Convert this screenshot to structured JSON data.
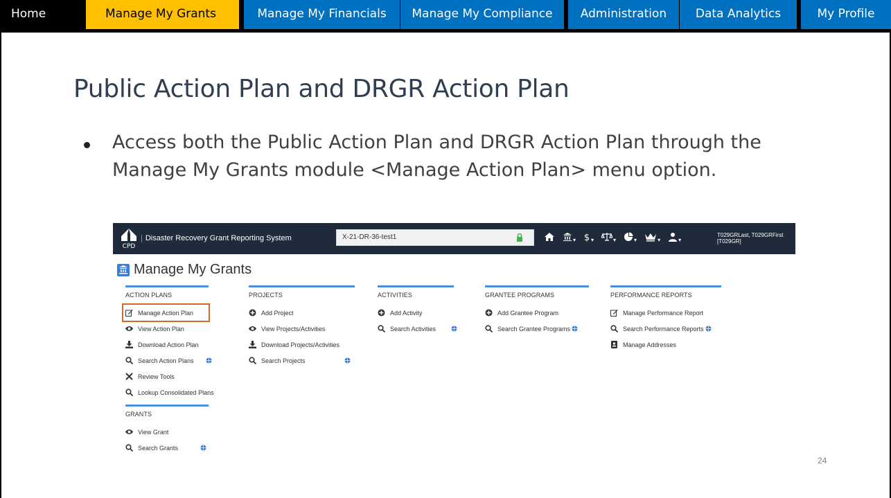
{
  "nav": {
    "tabs": [
      {
        "label": "Home"
      },
      {
        "label": "Manage My Grants"
      },
      {
        "label": "Manage My Financials"
      },
      {
        "label": "Manage My Compliance"
      },
      {
        "label": "Administration"
      },
      {
        "label": "Data Analytics"
      },
      {
        "label": "My Profile"
      }
    ],
    "active_color": "#ffc000",
    "tab_color": "#0070c0"
  },
  "slide": {
    "title": "Public Action Plan and DRGR Action Plan",
    "bullet": "Access both the Public Action Plan and DRGR Action Plan through the Manage My Grants module <Manage Action Plan> menu option.",
    "page_number": "24"
  },
  "screenshot": {
    "logo_text": "CPD",
    "system_title": "Disaster Recovery Grant Reporting System",
    "grant_field_value": "X-21-DR-36-test1",
    "user_line1": "T029GRLast, T029GRFirst",
    "user_line2": "[T029GR]",
    "page_heading": "Manage My Grants",
    "columns": {
      "action_plans": {
        "header": "ACTION PLANS",
        "items": [
          "Manage Action Plan",
          "View Action Plan",
          "Download Action Plan",
          "Search Action Plans",
          "Review Tools",
          "Lookup Consolidated Plans"
        ]
      },
      "grants": {
        "header": "GRANTS",
        "items": [
          "View Grant",
          "Search Grants"
        ]
      },
      "projects": {
        "header": "PROJECTS",
        "items": [
          "Add Project",
          "View Projects/Activities",
          "Download Projects/Activities",
          "Search Projects"
        ]
      },
      "activities": {
        "header": "ACTIVITIES",
        "items": [
          "Add Activity",
          "Search Activities"
        ]
      },
      "grantee_programs": {
        "header": "GRANTEE PROGRAMS",
        "items": [
          "Add Grantee Program",
          "Search Grantee Programs"
        ]
      },
      "performance_reports": {
        "header": "PERFORMANCE REPORTS",
        "items": [
          "Manage Performance Report",
          "Search Performance Reports",
          "Manage Addresses"
        ]
      }
    },
    "highlight_color": "#d06a2a",
    "header_bar_color": "#1f2b3b"
  }
}
